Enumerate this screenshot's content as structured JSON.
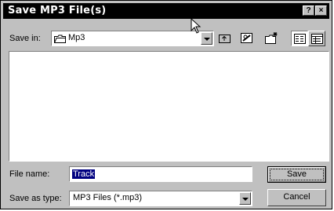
{
  "dialog": {
    "title": "Save MP3 File(s)",
    "help_button": "?",
    "close_button": "×"
  },
  "save_in": {
    "label": "Save in:",
    "value": "Mp3"
  },
  "toolbar": {
    "icons": [
      "up-one-level-icon",
      "desktop-icon",
      "new-folder-icon",
      "list-view-icon",
      "details-view-icon"
    ]
  },
  "file_name": {
    "label": "File name:",
    "value": "Track"
  },
  "save_as_type": {
    "label": "Save as type:",
    "value": "MP3 Files (*.mp3)"
  },
  "buttons": {
    "save": "Save",
    "cancel": "Cancel"
  }
}
